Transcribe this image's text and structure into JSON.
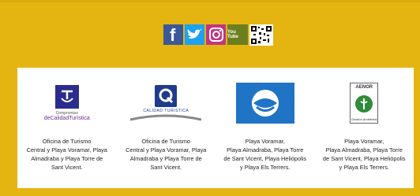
{
  "social": {
    "facebook": "facebook-icon",
    "twitter": "twitter-icon",
    "instagram": "instagram-icon",
    "youtube": "youtube-icon",
    "youtube_label": "You Tube",
    "qr": "qr-code-icon"
  },
  "certifications": [
    {
      "logo_label_small": "Compromiso",
      "logo_label_main": "deCalidadTurística",
      "text_lines": [
        "Oficina de Turismo",
        "Central y Playa Voramar, Playa",
        "Almadraba y Playa Torre de",
        "Sant Vicent."
      ]
    },
    {
      "logo_label_main": "CALIDAD TURISTICA",
      "text_lines": [
        "Oficina de Turismo",
        "Central y Playa Voramar, Playa",
        "Almadraba y Playa Torre de",
        "Sant Vicent."
      ]
    },
    {
      "text_lines": [
        "Playa Voramar,",
        "Playa Almadraba, Playa Torre",
        "de Sant Vicent, Playa Heliópolis",
        "y Playa Els Terrers."
      ]
    },
    {
      "logo_label_top": "AENOR",
      "logo_label_bottom": "Gestión Ambiental",
      "text_lines": [
        "Playa Voramar,",
        "Playa Almadraba, Playa Torre",
        "de Sant Vicent, Playa Heliópolis",
        "y Playa Els Terrers."
      ]
    }
  ],
  "colors": {
    "background": "#e4b411",
    "panel": "#ffffff",
    "blue_flag": "#1f74c6"
  }
}
